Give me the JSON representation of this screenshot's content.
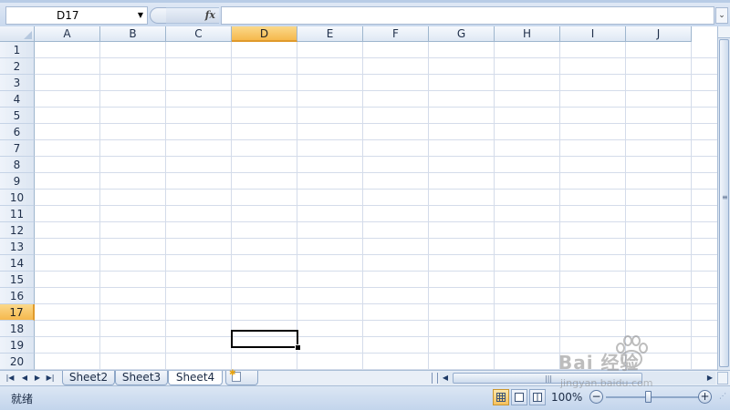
{
  "formula_bar": {
    "name_box": "D17",
    "fx_label": "fx",
    "formula_value": ""
  },
  "grid": {
    "columns": [
      "A",
      "B",
      "C",
      "D",
      "E",
      "F",
      "G",
      "H",
      "I",
      "J"
    ],
    "rows": [
      "1",
      "2",
      "3",
      "4",
      "5",
      "6",
      "7",
      "8",
      "9",
      "10",
      "11",
      "12",
      "13",
      "14",
      "15",
      "16",
      "17",
      "18",
      "19",
      "20"
    ],
    "active_column": "D",
    "active_row": "17"
  },
  "sheet_tabs": [
    {
      "label": "Sheet2",
      "active": false
    },
    {
      "label": "Sheet3",
      "active": false
    },
    {
      "label": "Sheet4",
      "active": true
    }
  ],
  "status_bar": {
    "status": "就绪",
    "zoom": "100%",
    "zoom_out_label": "−",
    "zoom_in_label": "+"
  },
  "watermark": {
    "logo": "Bai 经验",
    "url": "jingyan.baidu.com"
  },
  "colors": {
    "accent_header": "#f5b84d",
    "gridline": "#d4dcea"
  }
}
